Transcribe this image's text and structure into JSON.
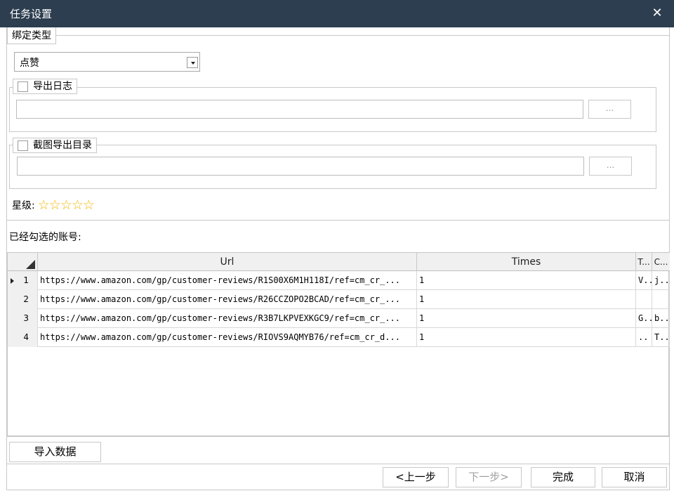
{
  "window": {
    "title": "任务设置",
    "close_glyph": "✕"
  },
  "bind_type": {
    "legend": "绑定类型",
    "selected": "点赞"
  },
  "export_log": {
    "label": "导出日志",
    "checked": false,
    "path": "",
    "browse_label": "..."
  },
  "screenshot_dir": {
    "label": "截图导出目录",
    "checked": false,
    "path": "",
    "browse_label": "..."
  },
  "rating": {
    "label": "星级:",
    "stars": 5
  },
  "accounts": {
    "label": "已经勾选的账号:",
    "columns": [
      "Url",
      "Times",
      "T...",
      "C..."
    ],
    "rows": [
      {
        "num": "1",
        "url": "https://www.amazon.com/gp/customer-reviews/R1S00X6M1H118I/ref=cm_cr_...",
        "times": "1",
        "t": "V...",
        "c": "j..."
      },
      {
        "num": "2",
        "url": "https://www.amazon.com/gp/customer-reviews/R26CCZOPO2BCAD/ref=cm_cr_...",
        "times": "1",
        "t": "",
        "c": ""
      },
      {
        "num": "3",
        "url": "https://www.amazon.com/gp/customer-reviews/R3B7LKPVEXKGC9/ref=cm_cr_...",
        "times": "1",
        "t": "G...",
        "c": "b..."
      },
      {
        "num": "4",
        "url": "https://www.amazon.com/gp/customer-reviews/RIOVS9AQMYB76/ref=cm_cr_d...",
        "times": "1",
        "t": "..",
        "c": "T..."
      }
    ]
  },
  "buttons": {
    "import": "导入数据",
    "prev": "<上一步",
    "next": "下一步>",
    "finish": "完成",
    "cancel": "取消"
  }
}
